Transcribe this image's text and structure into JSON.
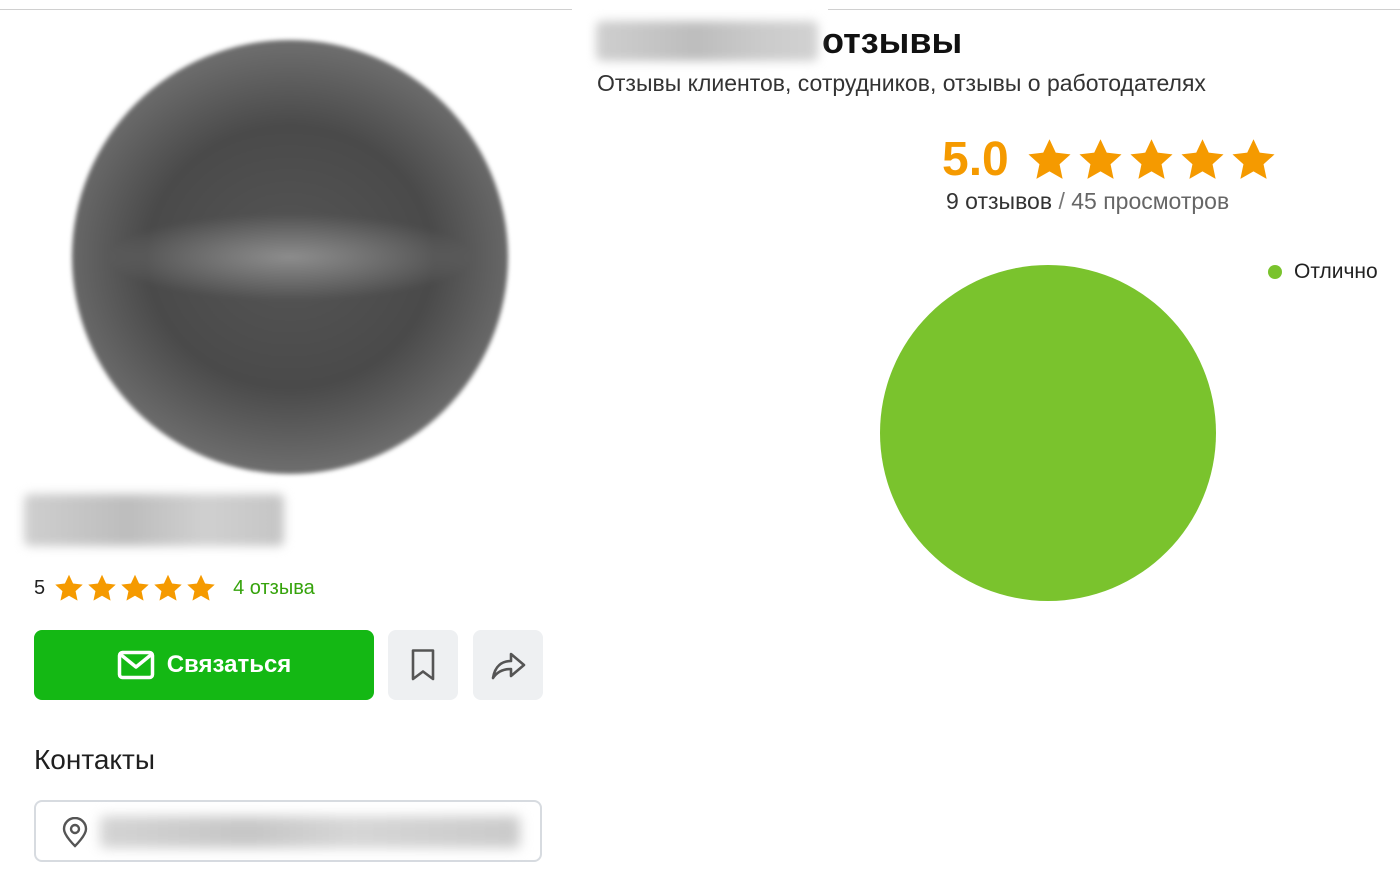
{
  "profile": {
    "rating_value": "5",
    "stars_count": 5,
    "reviews_link": "4 отзыва",
    "contact_button": "Связаться",
    "contacts_title": "Контакты"
  },
  "reviews_panel": {
    "heading_word": "отзывы",
    "subtitle": "Отзывы клиентов, сотрудников, отзывы о работодателях",
    "score": "5.0",
    "reviews_count": "9 отзывов",
    "separator": "/",
    "views_count": "45 просмотров"
  },
  "icons": [
    "star-icon",
    "mail-icon",
    "bookmark-icon",
    "share-icon",
    "location-pin-icon"
  ],
  "colors": {
    "star": "#f59a00",
    "contact_button": "#14b814",
    "reviews_link": "#36a30c",
    "pie_excellent": "#7ac32d"
  },
  "chart_data": {
    "type": "pie",
    "categories": [
      "Отлично"
    ],
    "values": [
      100
    ],
    "colors": [
      "#7ac32d"
    ],
    "legend_position": "top-right"
  }
}
